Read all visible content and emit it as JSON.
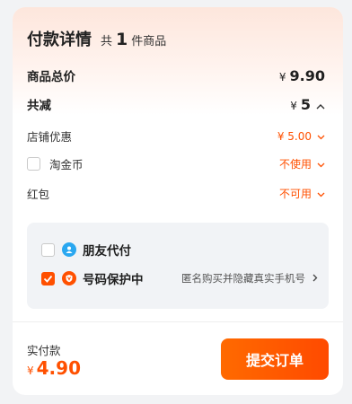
{
  "header": {
    "title": "付款详情",
    "count_prefix": "共",
    "count": "1",
    "count_suffix": "件商品"
  },
  "summary": {
    "label": "商品总价",
    "currency": "¥",
    "amount": "9.90"
  },
  "discount": {
    "label": "共减",
    "currency": "¥",
    "amount": "5"
  },
  "store_coupon": {
    "label": "店铺优惠",
    "value": "¥ 5.00"
  },
  "taojinbi": {
    "label": "淘金币",
    "value": "不使用",
    "checked": false
  },
  "red_packet": {
    "label": "红包",
    "value": "不可用"
  },
  "options": {
    "friend_pay": {
      "label": "朋友代付",
      "checked": false
    },
    "number_protect": {
      "label": "号码保护中",
      "hint": "匿名购买并隐藏真实手机号",
      "checked": true
    }
  },
  "footer": {
    "pay_label": "实付款",
    "currency": "¥",
    "amount": "4.90",
    "submit_label": "提交订单"
  },
  "colors": {
    "accent": "#ff5000",
    "friend_icon": "#2aa7f0",
    "shield_icon": "#ff5000"
  },
  "icons": {
    "friend": "friend-pay-icon",
    "shield": "shield-icon",
    "chevron_up": "chevron-up-icon",
    "chevron_down": "chevron-down-icon",
    "chevron_right": "chevron-right-icon"
  }
}
